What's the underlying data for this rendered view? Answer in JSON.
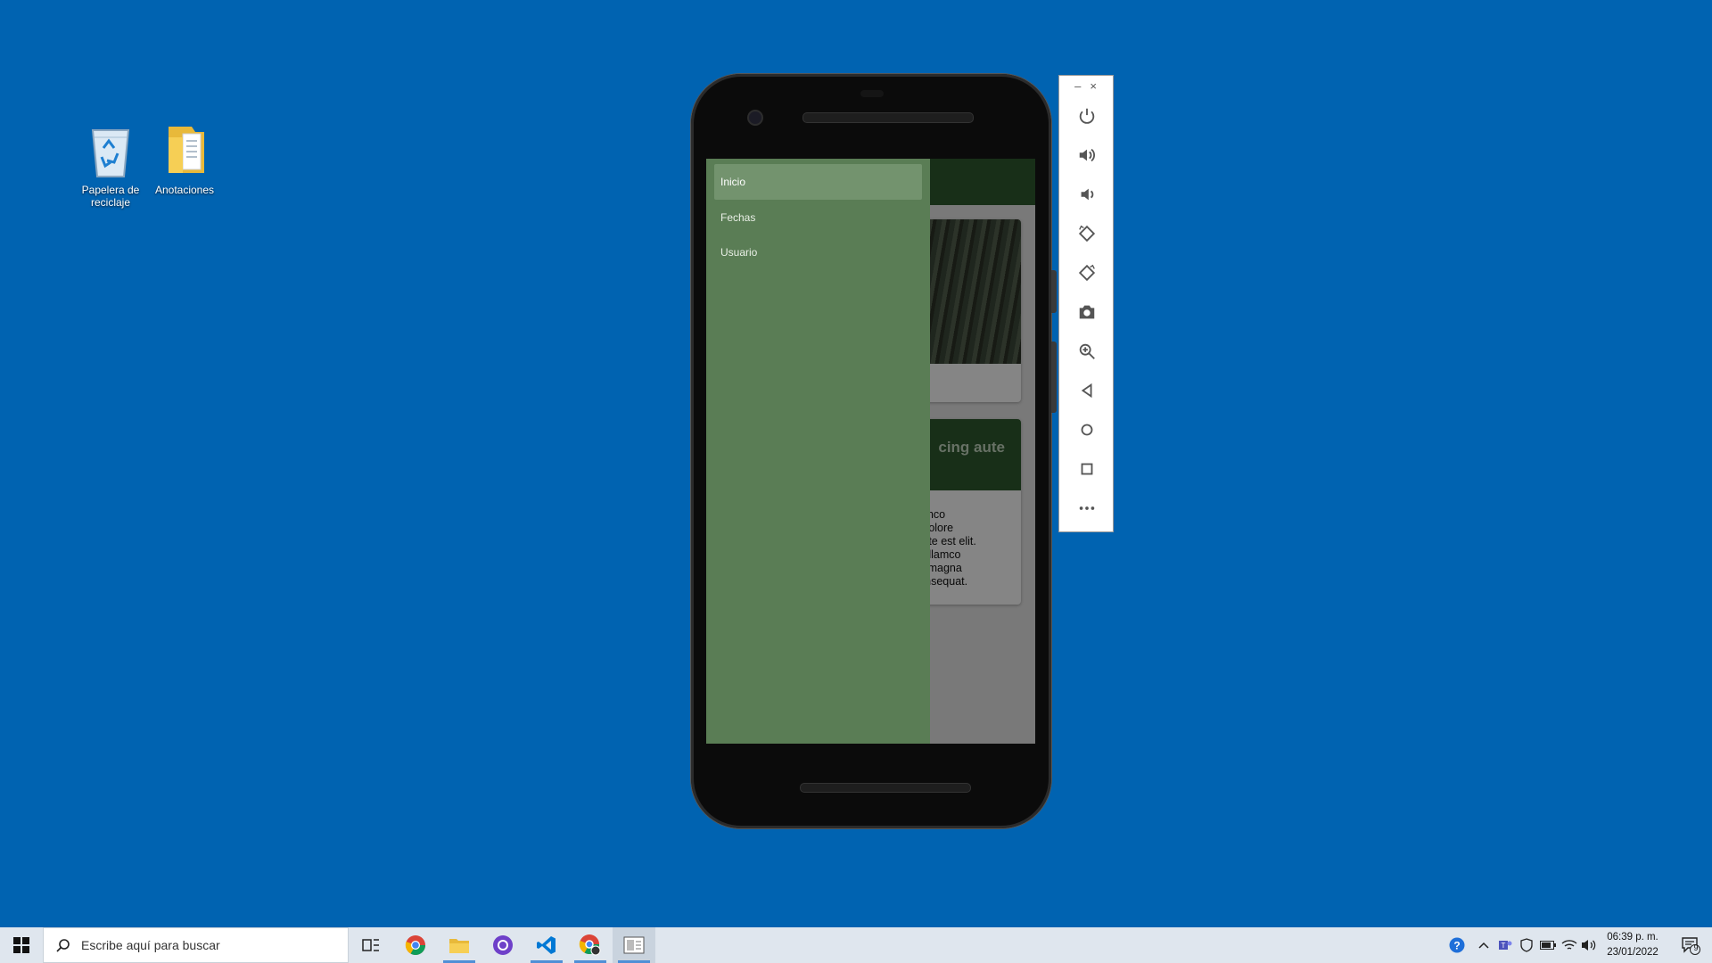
{
  "desktop": {
    "icons": [
      {
        "label": "Papelera de reciclaje",
        "icon": "recycle-bin-icon"
      },
      {
        "label": "Anotaciones",
        "icon": "folder-icon"
      }
    ]
  },
  "app": {
    "drawer": {
      "items": [
        {
          "label": "Inicio",
          "active": true
        },
        {
          "label": "Fechas",
          "active": false
        },
        {
          "label": "Usuario",
          "active": false
        }
      ]
    },
    "card2": {
      "title_fragment": "cing aute",
      "body_fragment": "ullamco\non dolore\nd aute est elit.\nod ullamco\niam magna\nt consequat."
    },
    "colors": {
      "drawer": "#5a7d55",
      "drawer_active": "#73936e",
      "app_bar": "#2e5a2e"
    }
  },
  "emulator_toolbar": {
    "window_controls": [
      "–",
      "×"
    ],
    "buttons": [
      "power-icon",
      "volume-up-icon",
      "volume-down-icon",
      "rotate-left-icon",
      "rotate-right-icon",
      "camera-icon",
      "zoom-icon",
      "back-icon",
      "home-icon",
      "overview-icon",
      "more-icon"
    ]
  },
  "taskbar": {
    "search_placeholder": "Escribe aquí para buscar",
    "apps": [
      "task-view-icon",
      "chrome-icon",
      "file-explorer-icon",
      "github-desktop-icon",
      "vscode-icon",
      "chrome-profile-icon",
      "emulator-icon"
    ],
    "clock_time": "06:39 p. m.",
    "clock_date": "23/01/2022",
    "notification_count": "9"
  }
}
